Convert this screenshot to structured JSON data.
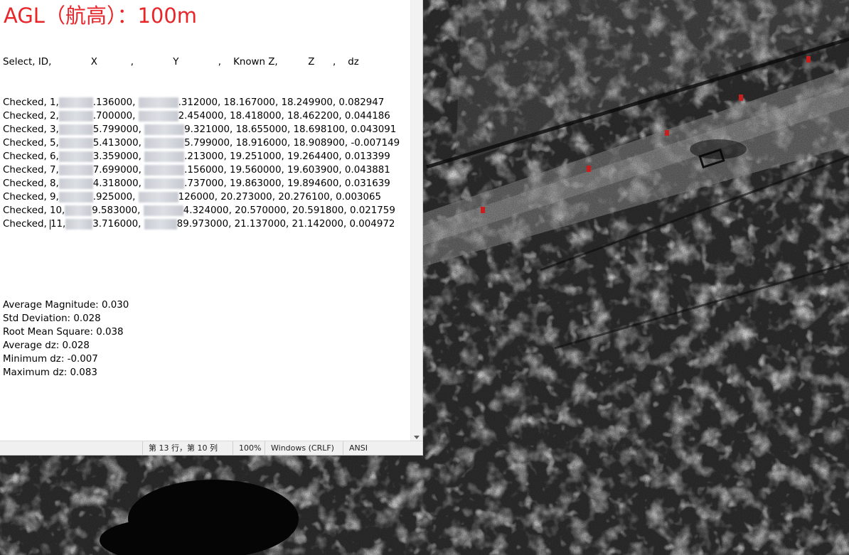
{
  "overlay_title": "AGL（航高）：100m",
  "report": {
    "header": [
      "Select,",
      "ID,",
      "X",
      ",",
      "Y",
      ",",
      "Known Z,",
      "Z",
      ",",
      "dz"
    ],
    "rows": [
      {
        "select": "Checked",
        "id": "1",
        "x_tail": ".136000",
        "y_tail": ".312000",
        "known_z": "18.167000",
        "z": "18.249900",
        "dz": "0.082947"
      },
      {
        "select": "Checked",
        "id": "2",
        "x_tail": ".700000",
        "y_tail": "2.454000",
        "known_z": "18.418000",
        "z": "18.462200",
        "dz": "0.044186"
      },
      {
        "select": "Checked",
        "id": "3",
        "x_tail": "5.799000",
        "y_tail": "9.321000",
        "known_z": "18.655000",
        "z": "18.698100",
        "dz": "0.043091"
      },
      {
        "select": "Checked",
        "id": "5",
        "x_tail": "5.413000",
        "y_tail": "5.799000",
        "known_z": "18.916000",
        "z": "18.908900",
        "dz": "-0.007149"
      },
      {
        "select": "Checked",
        "id": "6",
        "x_tail": "3.359000",
        "y_tail": ".213000",
        "known_z": "19.251000",
        "z": "19.264400",
        "dz": "0.013399"
      },
      {
        "select": "Checked",
        "id": "7",
        "x_tail": "7.699000",
        "y_tail": ".156000",
        "known_z": "19.560000",
        "z": "19.603900",
        "dz": "0.043881"
      },
      {
        "select": "Checked",
        "id": "8",
        "x_tail": "4.318000",
        "y_tail": ".737000",
        "known_z": "19.863000",
        "z": "19.894600",
        "dz": "0.031639"
      },
      {
        "select": "Checked",
        "id": "9",
        "x_tail": ".925000",
        "y_tail": "126000",
        "known_z": "20.273000",
        "z": "20.276100",
        "dz": "0.003065"
      },
      {
        "select": "Checked",
        "id": "10",
        "x_tail": "9.583000",
        "y_tail": "4.324000",
        "known_z": "20.570000",
        "z": "20.591800",
        "dz": "0.021759"
      },
      {
        "select": "Checked",
        "id": "11",
        "x_tail": "3.716000",
        "y_tail": "89.973000",
        "known_z": "21.137000",
        "z": "21.142000",
        "dz": "0.004972"
      }
    ],
    "summary": [
      "Average Magnitude: 0.030",
      "Std Deviation: 0.028",
      "Root Mean Square: 0.038",
      "Average dz: 0.028",
      "Minimum dz: -0.007",
      "Maximum dz: 0.083"
    ]
  },
  "statusbar": {
    "position": "第 13 行，第 10 列",
    "zoom": "100%",
    "line_ending": "Windows (CRLF)",
    "encoding": "ANSI"
  },
  "colors": {
    "title": "#e8262a",
    "gcp_marker": "#c81e1e"
  }
}
